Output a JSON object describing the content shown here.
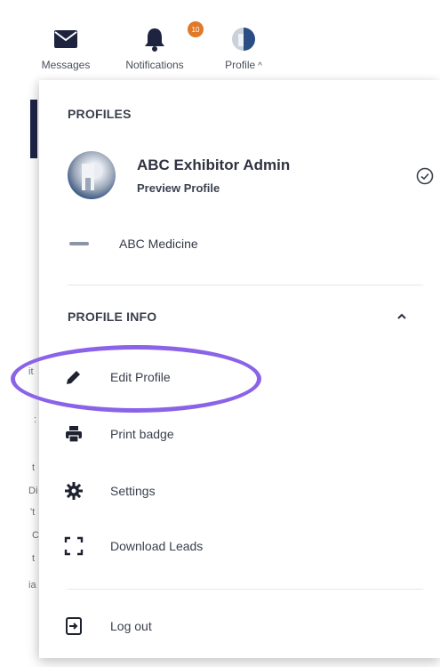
{
  "nav": {
    "messages": "Messages",
    "notifications": "Notifications",
    "notifications_badge": "10",
    "profile": "Profile"
  },
  "left_fragments": [
    "it",
    ":",
    "t",
    "Di",
    "'t",
    "C",
    "t",
    "ia"
  ],
  "dropdown": {
    "profiles_heading": "PROFILES",
    "active_profile": {
      "name": "ABC Exhibitor Admin",
      "subtitle": "Preview Profile"
    },
    "organization": {
      "name": "ABC Medicine"
    },
    "profile_info_heading": "PROFILE INFO",
    "menu": [
      {
        "label": "Edit Profile",
        "icon": "pencil-icon"
      },
      {
        "label": "Print badge",
        "icon": "printer-icon"
      },
      {
        "label": "Settings",
        "icon": "gear-icon"
      },
      {
        "label": "Download Leads",
        "icon": "scan-icon"
      }
    ],
    "logout": {
      "label": "Log out",
      "icon": "logout-icon"
    }
  },
  "colors": {
    "highlight": "#8a63e8",
    "notification_badge": "#e0792a",
    "sidebar_dark": "#1f2447"
  }
}
